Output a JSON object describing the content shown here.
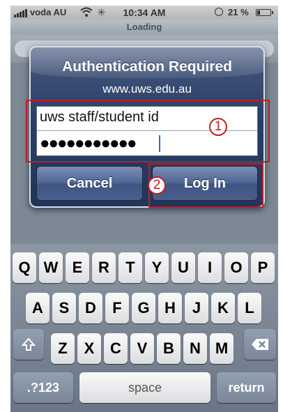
{
  "status": {
    "carrier": "voda AU",
    "time": "10:34 AM",
    "battery": "21 %",
    "battery_level": 0.21
  },
  "nav": {
    "title": "Loading"
  },
  "alert": {
    "title": "Authentication Required",
    "message": "www.uws.edu.au",
    "username_value": "uws staff/student id",
    "password_dots": "●●●●●●●●●●●",
    "cancel_label": "Cancel",
    "login_label": "Log In",
    "marker_1": "1",
    "marker_2": "2"
  },
  "keyboard": {
    "row1": [
      "Q",
      "W",
      "E",
      "R",
      "T",
      "Y",
      "U",
      "I",
      "O",
      "P"
    ],
    "row2": [
      "A",
      "S",
      "D",
      "F",
      "G",
      "H",
      "J",
      "K",
      "L"
    ],
    "row3": [
      "Z",
      "X",
      "C",
      "V",
      "B",
      "N",
      "M"
    ],
    "numbers_label": ".?123",
    "space_label": "space",
    "return_label": "return"
  },
  "colors": {
    "highlight": "#c01d23",
    "alert_bg": "#2b3f66"
  }
}
